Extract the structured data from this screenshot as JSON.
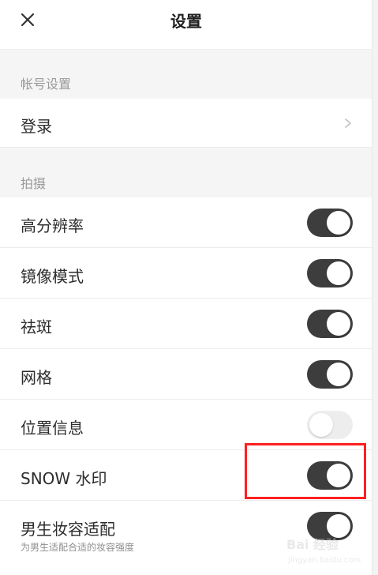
{
  "header": {
    "title": "设置"
  },
  "sections": {
    "account": {
      "label": "帐号设置",
      "login_label": "登录"
    },
    "shooting": {
      "label": "拍摄",
      "items": [
        {
          "label": "高分辨率",
          "state": "on"
        },
        {
          "label": "镜像模式",
          "state": "on"
        },
        {
          "label": "祛斑",
          "state": "on"
        },
        {
          "label": "网格",
          "state": "on"
        },
        {
          "label": "位置信息",
          "state": "off"
        },
        {
          "label": "SNOW 水印",
          "state": "on"
        },
        {
          "label": "男生妆容适配",
          "state": "on",
          "subtitle": "为男生适配合适的妆容强度"
        }
      ]
    }
  },
  "watermark": {
    "brand": "Bai 经验",
    "domain": "jingyan.baidu.com"
  },
  "colors": {
    "toggle_on": "#3d3d3d",
    "toggle_off": "#ededed",
    "highlight": "#ff1f1f"
  },
  "icons": {
    "close": "close-icon",
    "chevron": "chevron-right-icon"
  }
}
